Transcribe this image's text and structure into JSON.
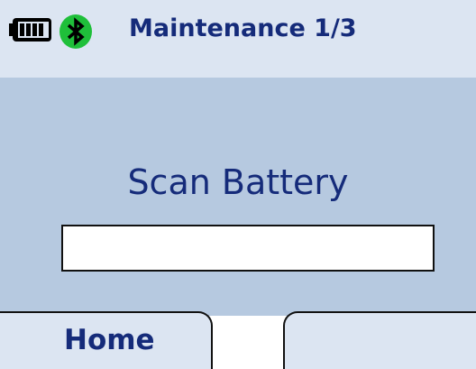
{
  "header": {
    "title": "Maintenance 1/3",
    "battery_icon": "battery-full-icon",
    "status_icon": "bluetooth-icon"
  },
  "main": {
    "prompt": "Scan Battery",
    "scan_input_value": ""
  },
  "softkeys": {
    "left_label": "Home",
    "right_label": ""
  },
  "colors": {
    "header_background": "#dce5f2",
    "panel_background": "#b6c9e0",
    "text": "#152b7a",
    "bluetooth_green": "#1fbf3a"
  }
}
